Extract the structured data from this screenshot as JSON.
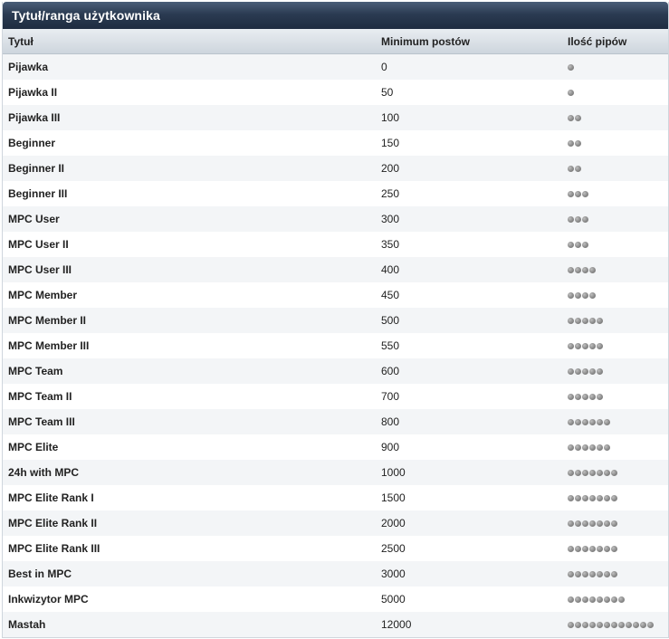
{
  "panel": {
    "title": "Tytuł/ranga użytkownika"
  },
  "table": {
    "headers": {
      "title": "Tytuł",
      "min_posts": "Minimum postów",
      "pips": "Ilość pipów"
    },
    "rows": [
      {
        "title": "Pijawka",
        "min_posts": "0",
        "pips": 1
      },
      {
        "title": "Pijawka II",
        "min_posts": "50",
        "pips": 1
      },
      {
        "title": "Pijawka III",
        "min_posts": "100",
        "pips": 2
      },
      {
        "title": "Beginner",
        "min_posts": "150",
        "pips": 2
      },
      {
        "title": "Beginner II",
        "min_posts": "200",
        "pips": 2
      },
      {
        "title": "Beginner III",
        "min_posts": "250",
        "pips": 3
      },
      {
        "title": "MPC User",
        "min_posts": "300",
        "pips": 3
      },
      {
        "title": "MPC User II",
        "min_posts": "350",
        "pips": 3
      },
      {
        "title": "MPC User III",
        "min_posts": "400",
        "pips": 4
      },
      {
        "title": "MPC Member",
        "min_posts": "450",
        "pips": 4
      },
      {
        "title": "MPC Member II",
        "min_posts": "500",
        "pips": 5
      },
      {
        "title": "MPC Member III",
        "min_posts": "550",
        "pips": 5
      },
      {
        "title": "MPC Team",
        "min_posts": "600",
        "pips": 5
      },
      {
        "title": "MPC Team II",
        "min_posts": "700",
        "pips": 5
      },
      {
        "title": "MPC Team III",
        "min_posts": "800",
        "pips": 6
      },
      {
        "title": "MPC Elite",
        "min_posts": "900",
        "pips": 6
      },
      {
        "title": "24h with MPC",
        "min_posts": "1000",
        "pips": 7
      },
      {
        "title": "MPC Elite Rank I",
        "min_posts": "1500",
        "pips": 7
      },
      {
        "title": "MPC Elite Rank II",
        "min_posts": "2000",
        "pips": 7
      },
      {
        "title": "MPC Elite Rank III",
        "min_posts": "2500",
        "pips": 7
      },
      {
        "title": "Best in MPC",
        "min_posts": "3000",
        "pips": 7
      },
      {
        "title": "Inkwizytor MPC",
        "min_posts": "5000",
        "pips": 8
      },
      {
        "title": "Mastah",
        "min_posts": "12000",
        "pips": 12
      }
    ]
  },
  "icons": {
    "pip": "pip-icon"
  }
}
